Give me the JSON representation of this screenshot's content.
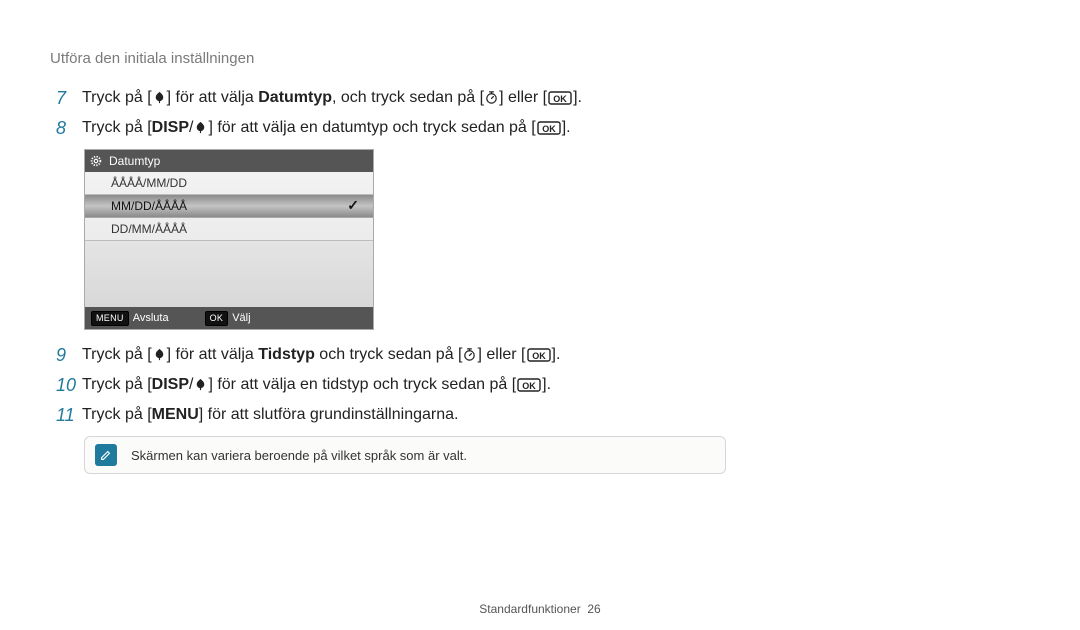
{
  "heading": "Utföra den initiala inställningen",
  "steps": {
    "s7": {
      "num": "7",
      "a": "Tryck på [",
      "b": "] för att välja ",
      "bold": "Datumtyp",
      "c": ", och tryck sedan på [",
      "d": "] eller ["
    },
    "s8": {
      "num": "8",
      "a": "Tryck på [",
      "mid": "] för att välja en datumtyp och tryck sedan på ["
    },
    "s9": {
      "num": "9",
      "a": "Tryck på [",
      "b": "] för att välja ",
      "bold": "Tidstyp",
      "c": " och tryck sedan på [",
      "d": "] eller ["
    },
    "s10": {
      "num": "10",
      "a": "Tryck på [",
      "mid": "] för att välja en tidstyp och tryck sedan på ["
    },
    "s11": {
      "num": "11",
      "a": "Tryck på [",
      "b": "] för att slutföra grundinställningarna."
    }
  },
  "panel": {
    "title": "Datumtyp",
    "opts": [
      "ÅÅÅÅ/MM/DD",
      "MM/DD/ÅÅÅÅ",
      "DD/MM/ÅÅÅÅ"
    ],
    "sel": 1,
    "foot": {
      "k1": "MENU",
      "l1": "Avsluta",
      "k2": "OK",
      "l2": "Välj"
    }
  },
  "disp": "DISP",
  "menu": "MENU",
  "ok_word": "OK",
  "note": "Skärmen kan variera beroende på vilket språk som är valt.",
  "footer": {
    "a": "Standardfunktioner",
    "b": "26"
  }
}
